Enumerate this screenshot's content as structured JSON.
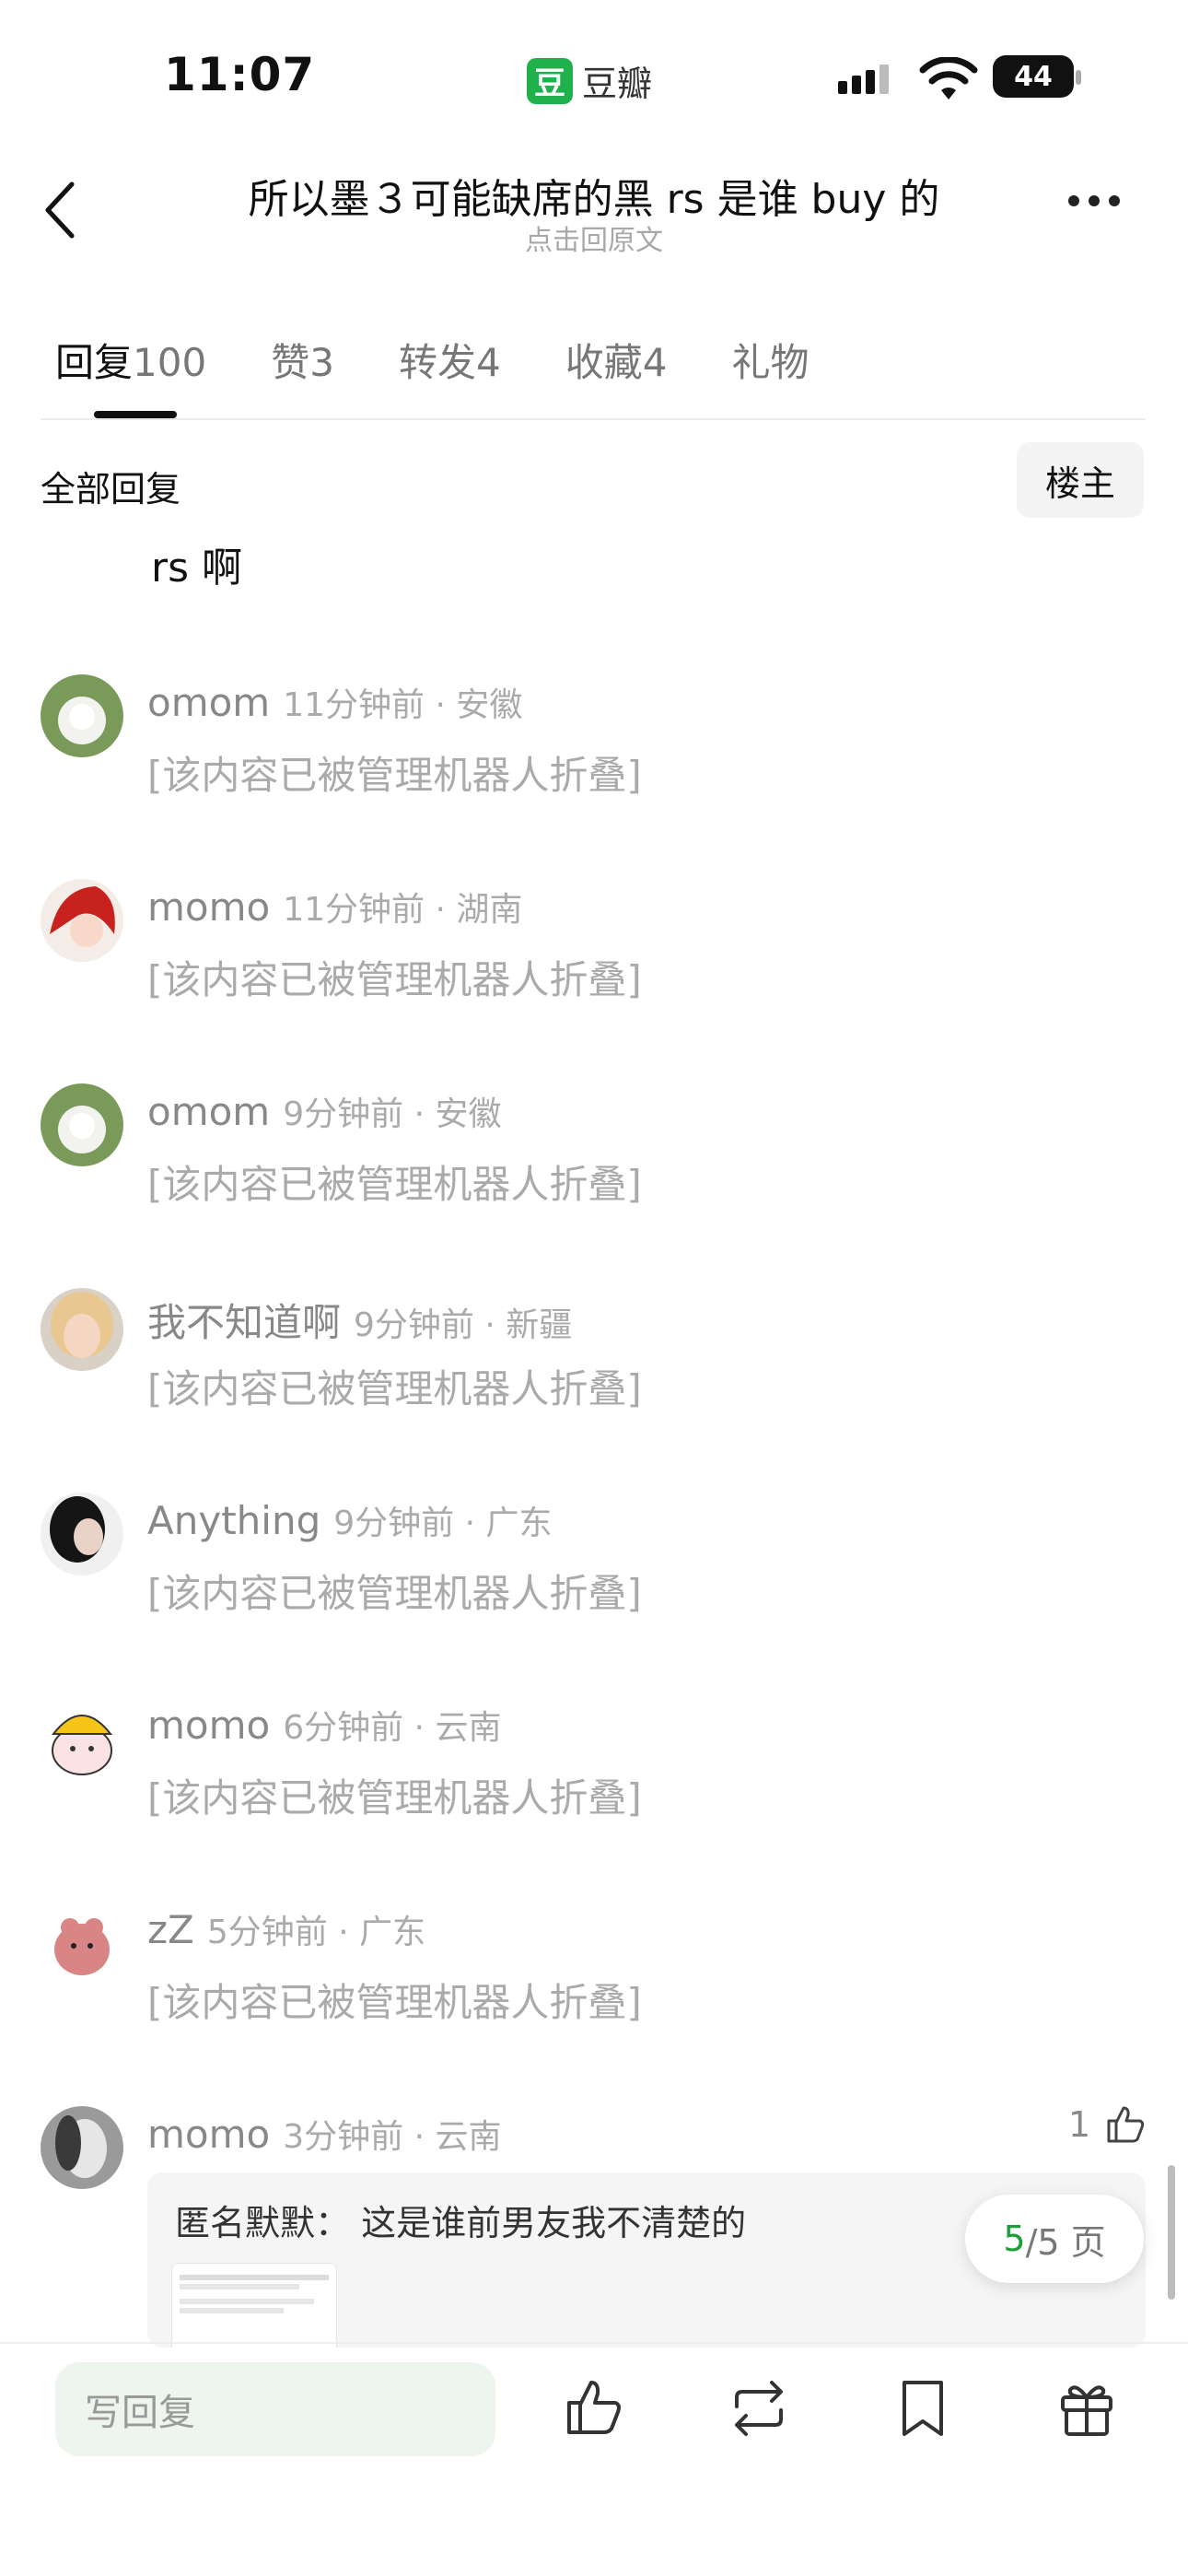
{
  "status_bar": {
    "time": "11:07",
    "app_logo_char": "豆",
    "app_name": "豆瓣",
    "battery": "44"
  },
  "header": {
    "title": "所以墨３可能缺席的黑 rs 是谁 buy 的",
    "subtitle": "点击回原文",
    "back_icon": "chevron-left-icon",
    "more_icon": "more-dots-icon"
  },
  "tabs": [
    {
      "label": "回复",
      "count": "100"
    },
    {
      "label": "赞",
      "count": "3"
    },
    {
      "label": "转发",
      "count": "4"
    },
    {
      "label": "收藏",
      "count": "4"
    },
    {
      "label": "礼物",
      "count": ""
    }
  ],
  "section": {
    "all_replies": "全部回复",
    "op_button": "楼主"
  },
  "partial_text": "rs 啊",
  "comments": [
    {
      "name": "omom",
      "time_loc": "11分钟前 · 安徽",
      "text": "[该内容已被管理机器人折叠]"
    },
    {
      "name": "momo",
      "time_loc": "11分钟前 · 湖南",
      "text": "[该内容已被管理机器人折叠]"
    },
    {
      "name": "omom",
      "time_loc": "9分钟前 · 安徽",
      "text": "[该内容已被管理机器人折叠]"
    },
    {
      "name": "我不知道啊",
      "time_loc": "9分钟前 · 新疆",
      "text": "[该内容已被管理机器人折叠]"
    },
    {
      "name": "Anything",
      "time_loc": "9分钟前 · 广东",
      "text": "[该内容已被管理机器人折叠]"
    },
    {
      "name": "momo",
      "time_loc": "6分钟前 · 云南",
      "text": "[该内容已被管理机器人折叠]"
    },
    {
      "name": "zZ",
      "time_loc": "5分钟前 · 广东",
      "text": "[该内容已被管理机器人折叠]"
    },
    {
      "name": "momo",
      "time_loc": "3分钟前 · 云南",
      "text": ""
    }
  ],
  "last_comment": {
    "likes": "1",
    "quote_author": "匿名默默：",
    "quote_text": "这是谁前男友我不清楚的"
  },
  "pager": {
    "current": "5",
    "total": "/5 页"
  },
  "bottom_bar": {
    "reply_placeholder": "写回复",
    "icons": [
      "like-icon",
      "repost-icon",
      "bookmark-icon",
      "gift-icon"
    ]
  },
  "colors": {
    "accent_green": "#1e9e3a",
    "brand_green": "#21b14c",
    "folded_text": "#aaaaaa"
  }
}
